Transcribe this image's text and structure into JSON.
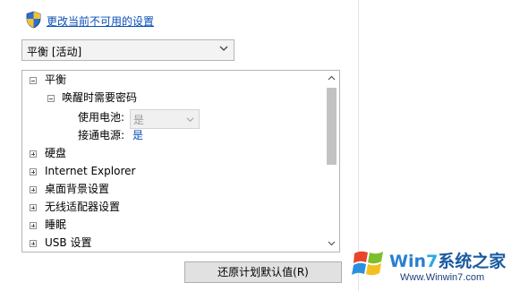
{
  "header": {
    "change_settings_link": "更改当前不可用的设置",
    "icons": {
      "shield": "uac-shield-icon"
    }
  },
  "plan_select": {
    "value": "平衡 [活动]",
    "icon": "chevron-down-icon"
  },
  "tree": {
    "items": [
      {
        "label": "平衡",
        "state": "expanded"
      },
      {
        "label": "唤醒时需要密码",
        "state": "expanded"
      },
      {
        "label": "使用电池:",
        "value": "是",
        "control": "disabled-dropdown"
      },
      {
        "label": "接通电源:",
        "value": "是",
        "control": "link"
      },
      {
        "label": "硬盘",
        "state": "collapsed"
      },
      {
        "label": "Internet Explorer",
        "state": "collapsed"
      },
      {
        "label": "桌面背景设置",
        "state": "collapsed"
      },
      {
        "label": "无线适配器设置",
        "state": "collapsed"
      },
      {
        "label": "睡眠",
        "state": "collapsed"
      },
      {
        "label": "USB 设置",
        "state": "collapsed"
      }
    ]
  },
  "buttons": {
    "restore_defaults": "还原计划默认值(R)"
  },
  "watermark": {
    "title_part1": "Win",
    "title_part2": "7",
    "title_part3": "系统之家",
    "url": "Www.Winwin7.com"
  },
  "colors": {
    "link": "#0a4fb8",
    "scroll_thumb": "#c2c2c2",
    "button_bg": "#e1e1e1"
  }
}
